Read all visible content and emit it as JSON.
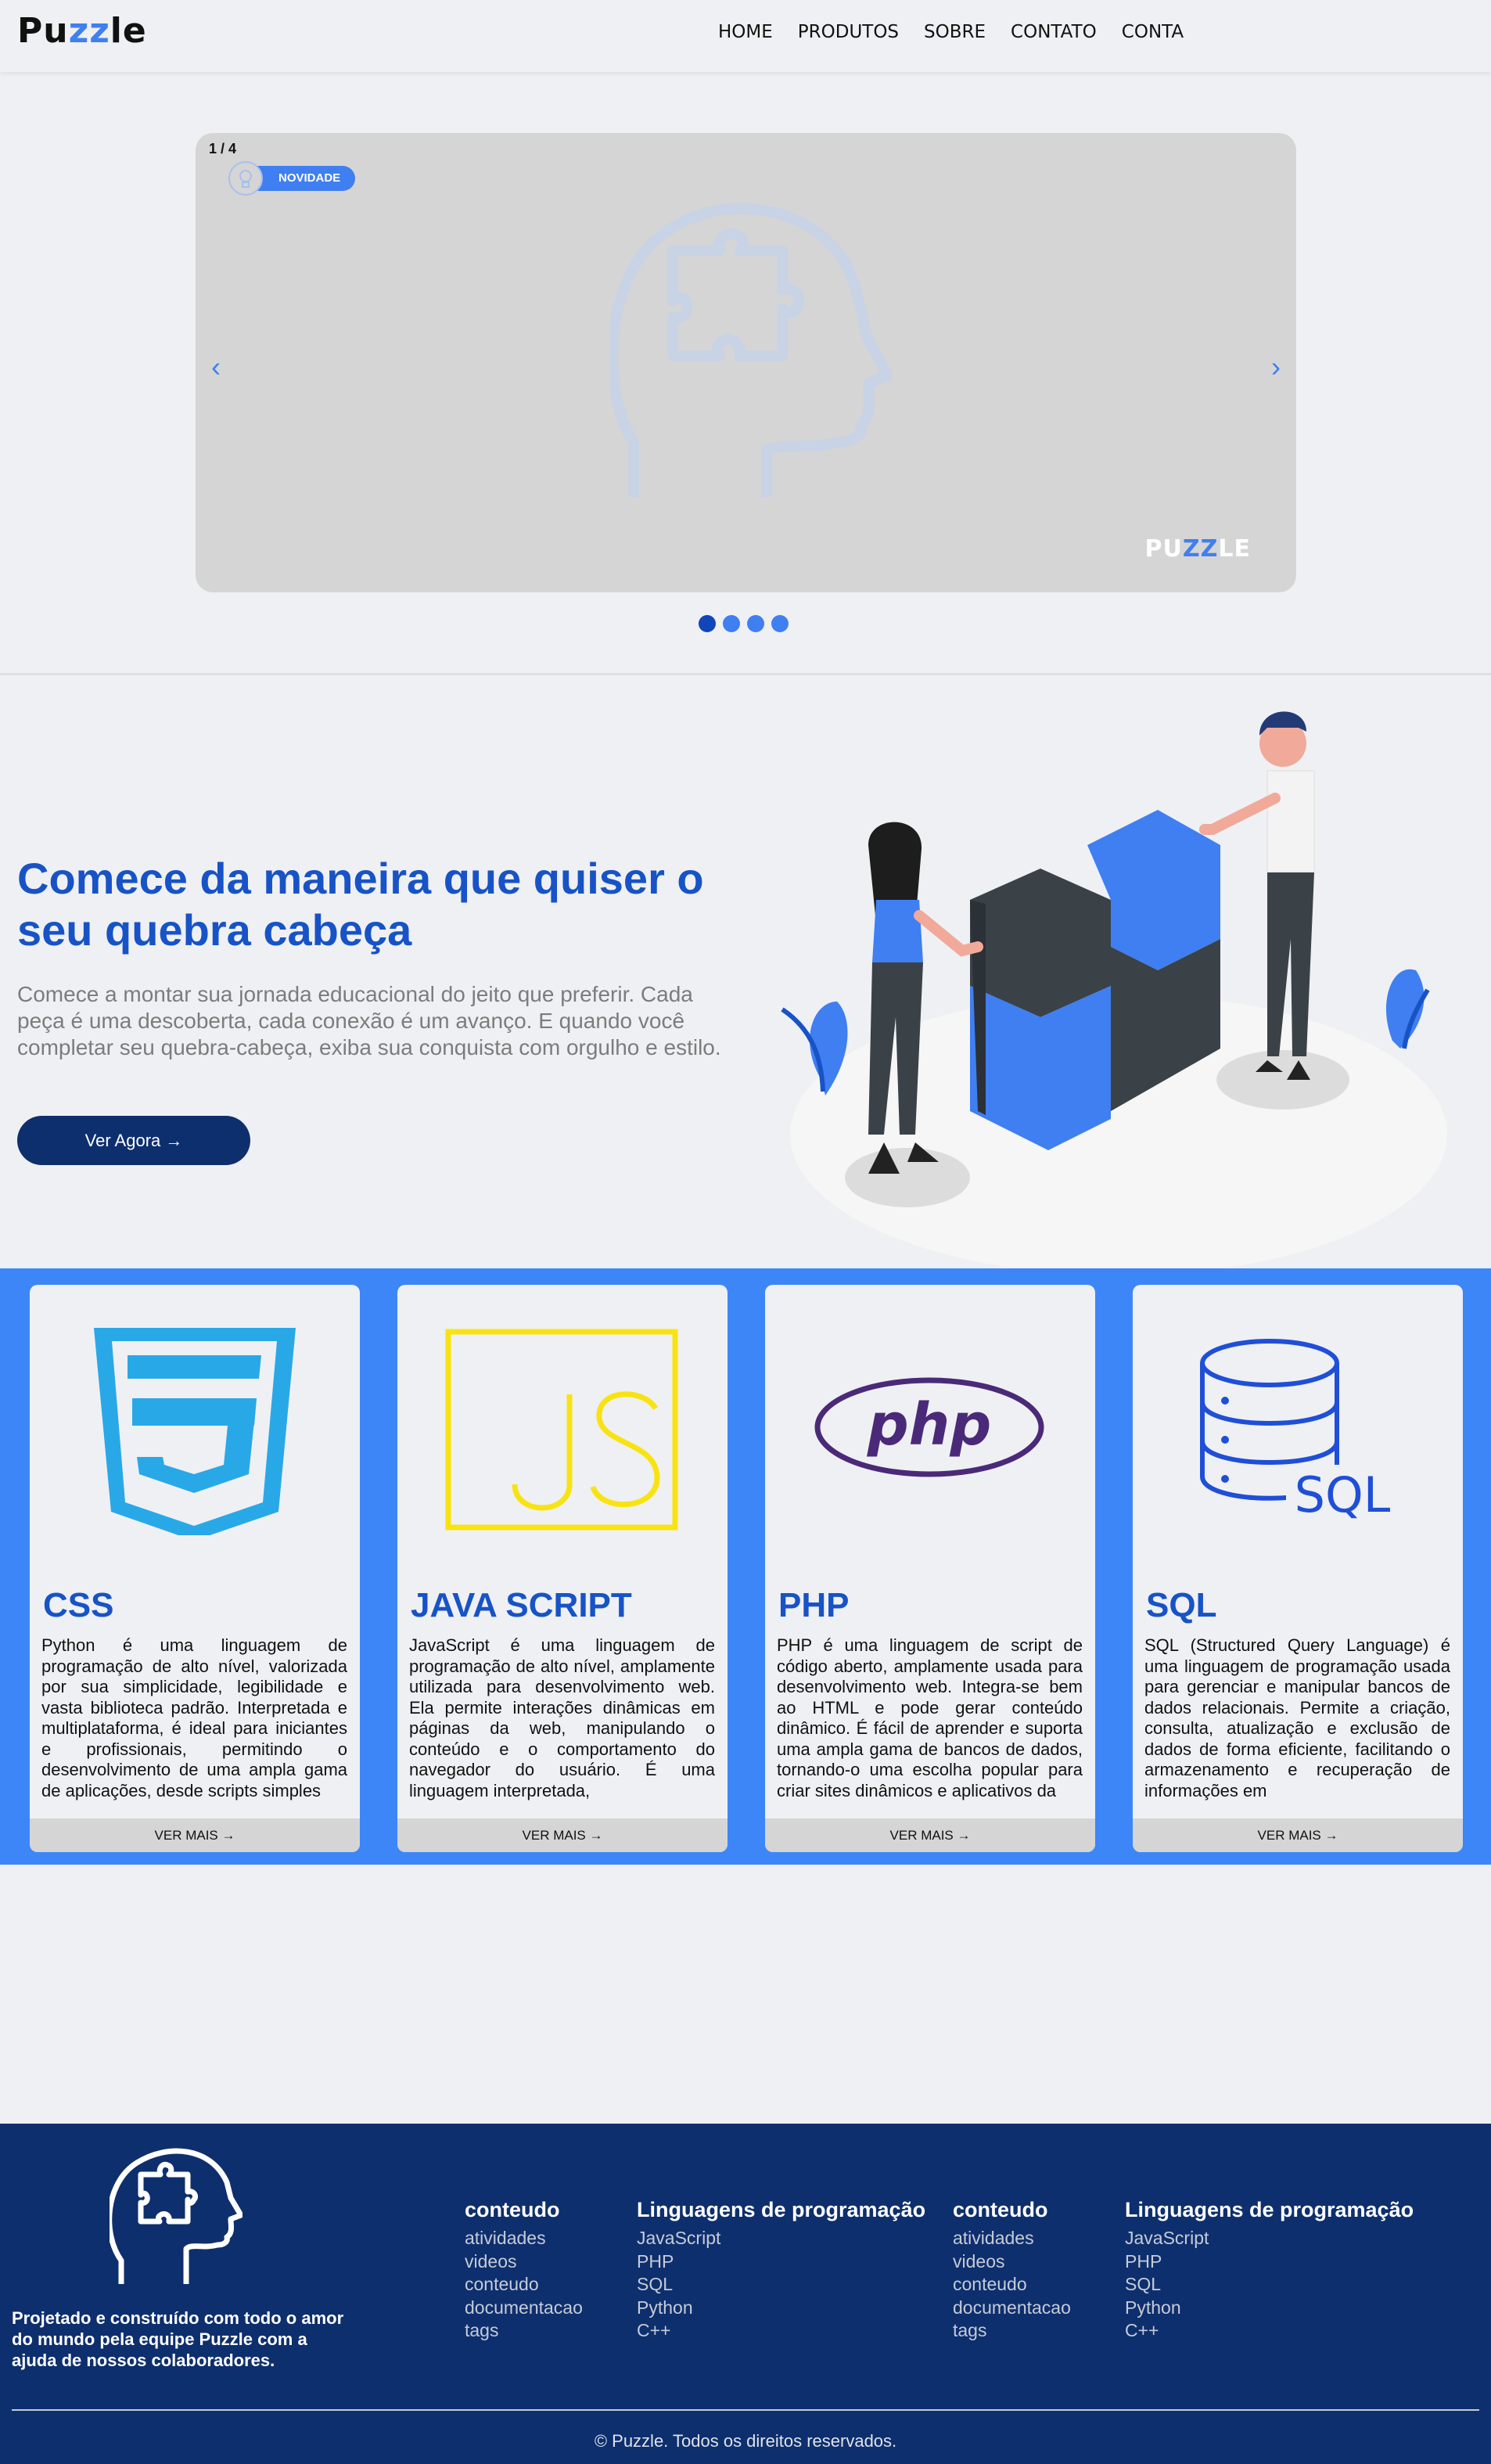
{
  "nav": {
    "logo_start": "Pu",
    "logo_mid": "zz",
    "logo_end": "le",
    "items": [
      "HOME",
      "PRODUTOS",
      "SOBRE",
      "CONTATO",
      "CONTA"
    ]
  },
  "carousel": {
    "counter": "1 / 4",
    "badge": "NOVIDADE",
    "prev": "‹",
    "next": "›",
    "logo_start": "PU",
    "logo_mid": "ZZ",
    "logo_end": "LE",
    "total_slides": 4,
    "active_slide": 1
  },
  "hero": {
    "title": "Comece da maneira que quiser o seu quebra cabeça",
    "text": "Comece a montar sua jornada educacional do jeito que preferir. Cada peça é uma descoberta, cada conexão é um avanço. E quando você completar seu quebra-cabeça, exiba sua conquista com orgulho e estilo.",
    "button": "Ver Agora →"
  },
  "cards": [
    {
      "title": "CSS",
      "icon": "css3-icon",
      "text": "Python é uma linguagem de programação de alto nível, valorizada por sua simplicidade, legibilidade e vasta biblioteca padrão. Interpretada e multiplataforma, é ideal para iniciantes e profissionais, permitindo o desenvolvimento de uma ampla gama de aplicações, desde scripts simples",
      "more": "VER MAIS →"
    },
    {
      "title": "JAVA SCRIPT",
      "icon": "javascript-icon",
      "text": "JavaScript é uma linguagem de programação de alto nível, amplamente utilizada para desenvolvimento web. Ela permite interações dinâmicas em páginas da web, manipulando o conteúdo e o comportamento do navegador do usuário. É uma linguagem interpretada,",
      "more": "VER MAIS →"
    },
    {
      "title": "PHP",
      "icon": "php-icon",
      "text": "PHP é uma linguagem de script de código aberto, amplamente usada para desenvolvimento web. Integra-se bem ao HTML e pode gerar conteúdo dinâmico. É fácil de aprender e suporta uma ampla gama de bancos de dados, tornando-o uma escolha popular para criar sites dinâmicos e aplicativos da",
      "more": "VER MAIS →"
    },
    {
      "title": "SQL",
      "icon": "sql-database-icon",
      "icon_label": "SQL",
      "text": "SQL (Structured Query Language) é uma linguagem de programação usada para gerenciar e manipular bancos de dados relacionais. Permite a criação, consulta, atualização e exclusão de dados de forma eficiente, facilitando o armazenamento e recuperação de informações em",
      "more": "VER MAIS →"
    }
  ],
  "footer": {
    "tagline": "Projetado e construído com todo o amor do mundo pela equipe Puzzle com a ajuda de nossos colaboradores.",
    "columns": [
      {
        "title": "conteudo",
        "links": [
          "atividades",
          "videos",
          "conteudo",
          "documentacao",
          "tags"
        ]
      },
      {
        "title": "Linguagens de programação",
        "links": [
          "JavaScript",
          "PHP",
          "SQL",
          "Python",
          "C++"
        ]
      },
      {
        "title": "conteudo",
        "links": [
          "atividades",
          "videos",
          "conteudo",
          "documentacao",
          "tags"
        ]
      },
      {
        "title": "Linguagens de programação",
        "links": [
          "JavaScript",
          "PHP",
          "SQL",
          "Python",
          "C++"
        ]
      }
    ],
    "copyright": "© Puzzle. Todos os direitos reservados."
  },
  "colors": {
    "accent": "#3f7ff1",
    "dark_blue": "#0e2f6d",
    "title_blue": "#1753c7",
    "band_blue": "#3d86f7",
    "background": "#eff0f3"
  }
}
